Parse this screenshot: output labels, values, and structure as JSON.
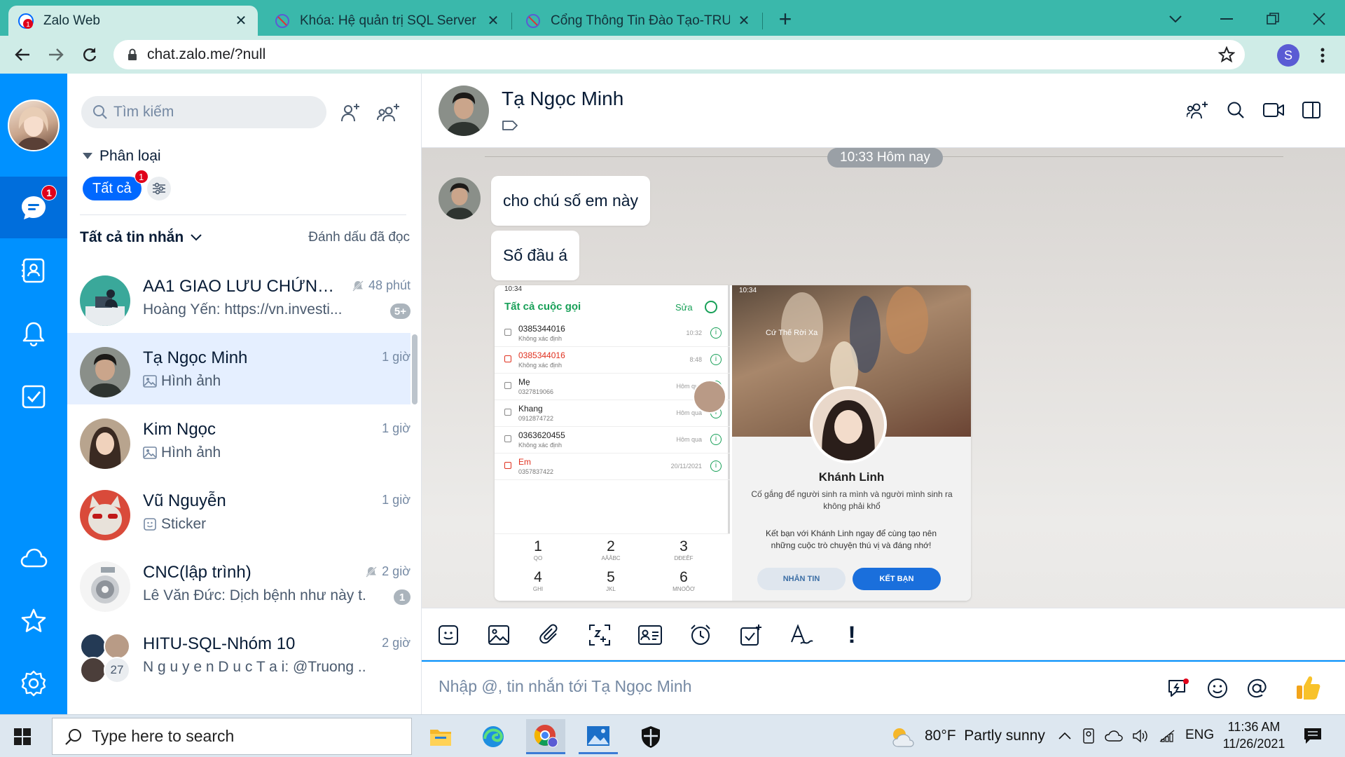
{
  "browser": {
    "tabs": [
      {
        "title": "Zalo Web",
        "active": true
      },
      {
        "title": "Khóa: Hệ quản trị SQL Server - N",
        "active": false
      },
      {
        "title": "Cổng Thông Tin Đào Tạo-TRƯỜN",
        "active": false
      }
    ],
    "new_tab": "+",
    "url": "chat.zalo.me/?null",
    "profile_initial": "S",
    "tab_badge": "1"
  },
  "nav": {
    "chat_badge": "1",
    "items": [
      "messages-icon",
      "contacts-icon",
      "notifications-icon",
      "todo-icon",
      "cloud-icon",
      "star-icon",
      "settings-icon"
    ]
  },
  "list": {
    "search_placeholder": "Tìm kiếm",
    "category_label": "Phân loại",
    "filter_all": "Tất cả",
    "filter_badge": "1",
    "all_messages": "Tất cả tin nhắn",
    "mark_read": "Đánh dấu đã đọc",
    "conversations": [
      {
        "name": "AA1 GIAO LƯU CHỨNG ...",
        "time": "48 phút",
        "preview": "Hoàng Yến: https://vn.investi...",
        "muted": true,
        "badge": "5+"
      },
      {
        "name": "Tạ Ngọc Minh",
        "time": "1 giờ",
        "preview": "Hình ảnh",
        "selected": true
      },
      {
        "name": "Kim Ngọc",
        "time": "1 giờ",
        "preview": "Hình ảnh"
      },
      {
        "name": "Vũ Nguyễn",
        "time": "1 giờ",
        "preview": "Sticker"
      },
      {
        "name": "CNC(lập trình)",
        "time": "2 giờ",
        "preview": "Lê Văn Đức: Dịch bệnh như này t...",
        "muted": true,
        "badge": "1"
      },
      {
        "name": "HITU-SQL-Nhóm 10",
        "time": "2 giờ",
        "preview": "N g u y e n D u c T a i: @Truong ...",
        "member_count": "27"
      }
    ]
  },
  "chat": {
    "name": "Tạ Ngọc Minh",
    "time_divider": "10:33 Hôm nay",
    "messages": [
      "cho chú số em này",
      "Số đầu á"
    ],
    "input_placeholder": "Nhập @, tin nhắn tới Tạ Ngọc Minh"
  },
  "image_left": {
    "header": "Tất cả cuộc gọi",
    "edit": "Sửa",
    "time": "10:34",
    "calls": [
      {
        "number": "0385344016",
        "sub": "Không xác định",
        "time": "10:32",
        "missed": false
      },
      {
        "number": "0385344016",
        "sub": "Không xác định",
        "time": "8:48",
        "missed": true
      },
      {
        "number": "Mẹ",
        "sub": "0327819066",
        "time": "Hôm qua",
        "missed": false
      },
      {
        "number": "Khang",
        "sub": "0912874722",
        "time": "Hôm qua",
        "missed": false
      },
      {
        "number": "0363620455",
        "sub": "Không xác định",
        "time": "Hôm qua",
        "missed": false
      },
      {
        "number": "Em",
        "sub": "0357837422",
        "time": "20/11/2021",
        "missed": true
      }
    ],
    "keypad": [
      {
        "d": "1",
        "l": "QO"
      },
      {
        "d": "2",
        "l": "AĂÂBC"
      },
      {
        "d": "3",
        "l": "DĐEÊF"
      },
      {
        "d": "4",
        "l": "GHI"
      },
      {
        "d": "5",
        "l": "JKL"
      },
      {
        "d": "6",
        "l": "MNOÔƠ"
      }
    ]
  },
  "image_right": {
    "time": "10:34",
    "song": "Cứ Thế Rời Xa",
    "name": "Khánh Linh",
    "bio": "Cố gắng để người sinh ra mình và người mình sinh ra không phải khổ",
    "cta": "Kết bạn với Khánh Linh ngay để cùng tạo nên những cuộc trò chuyện thú vị và đáng nhớ!",
    "btn_msg": "NHẮN TIN",
    "btn_add": "KẾT BẠN"
  },
  "taskbar": {
    "search_placeholder": "Type here to search",
    "weather_temp": "80°F",
    "weather_desc": "Partly sunny",
    "lang": "ENG",
    "time": "11:36 AM",
    "date": "11/26/2021"
  },
  "colors": {
    "zalo_blue": "#0091ff",
    "nav_active": "#006edc",
    "tab_teal": "#3ab8ab",
    "toolbar": "#cfece7",
    "selected_row": "#e5efff",
    "badge_red": "#e0001a"
  }
}
